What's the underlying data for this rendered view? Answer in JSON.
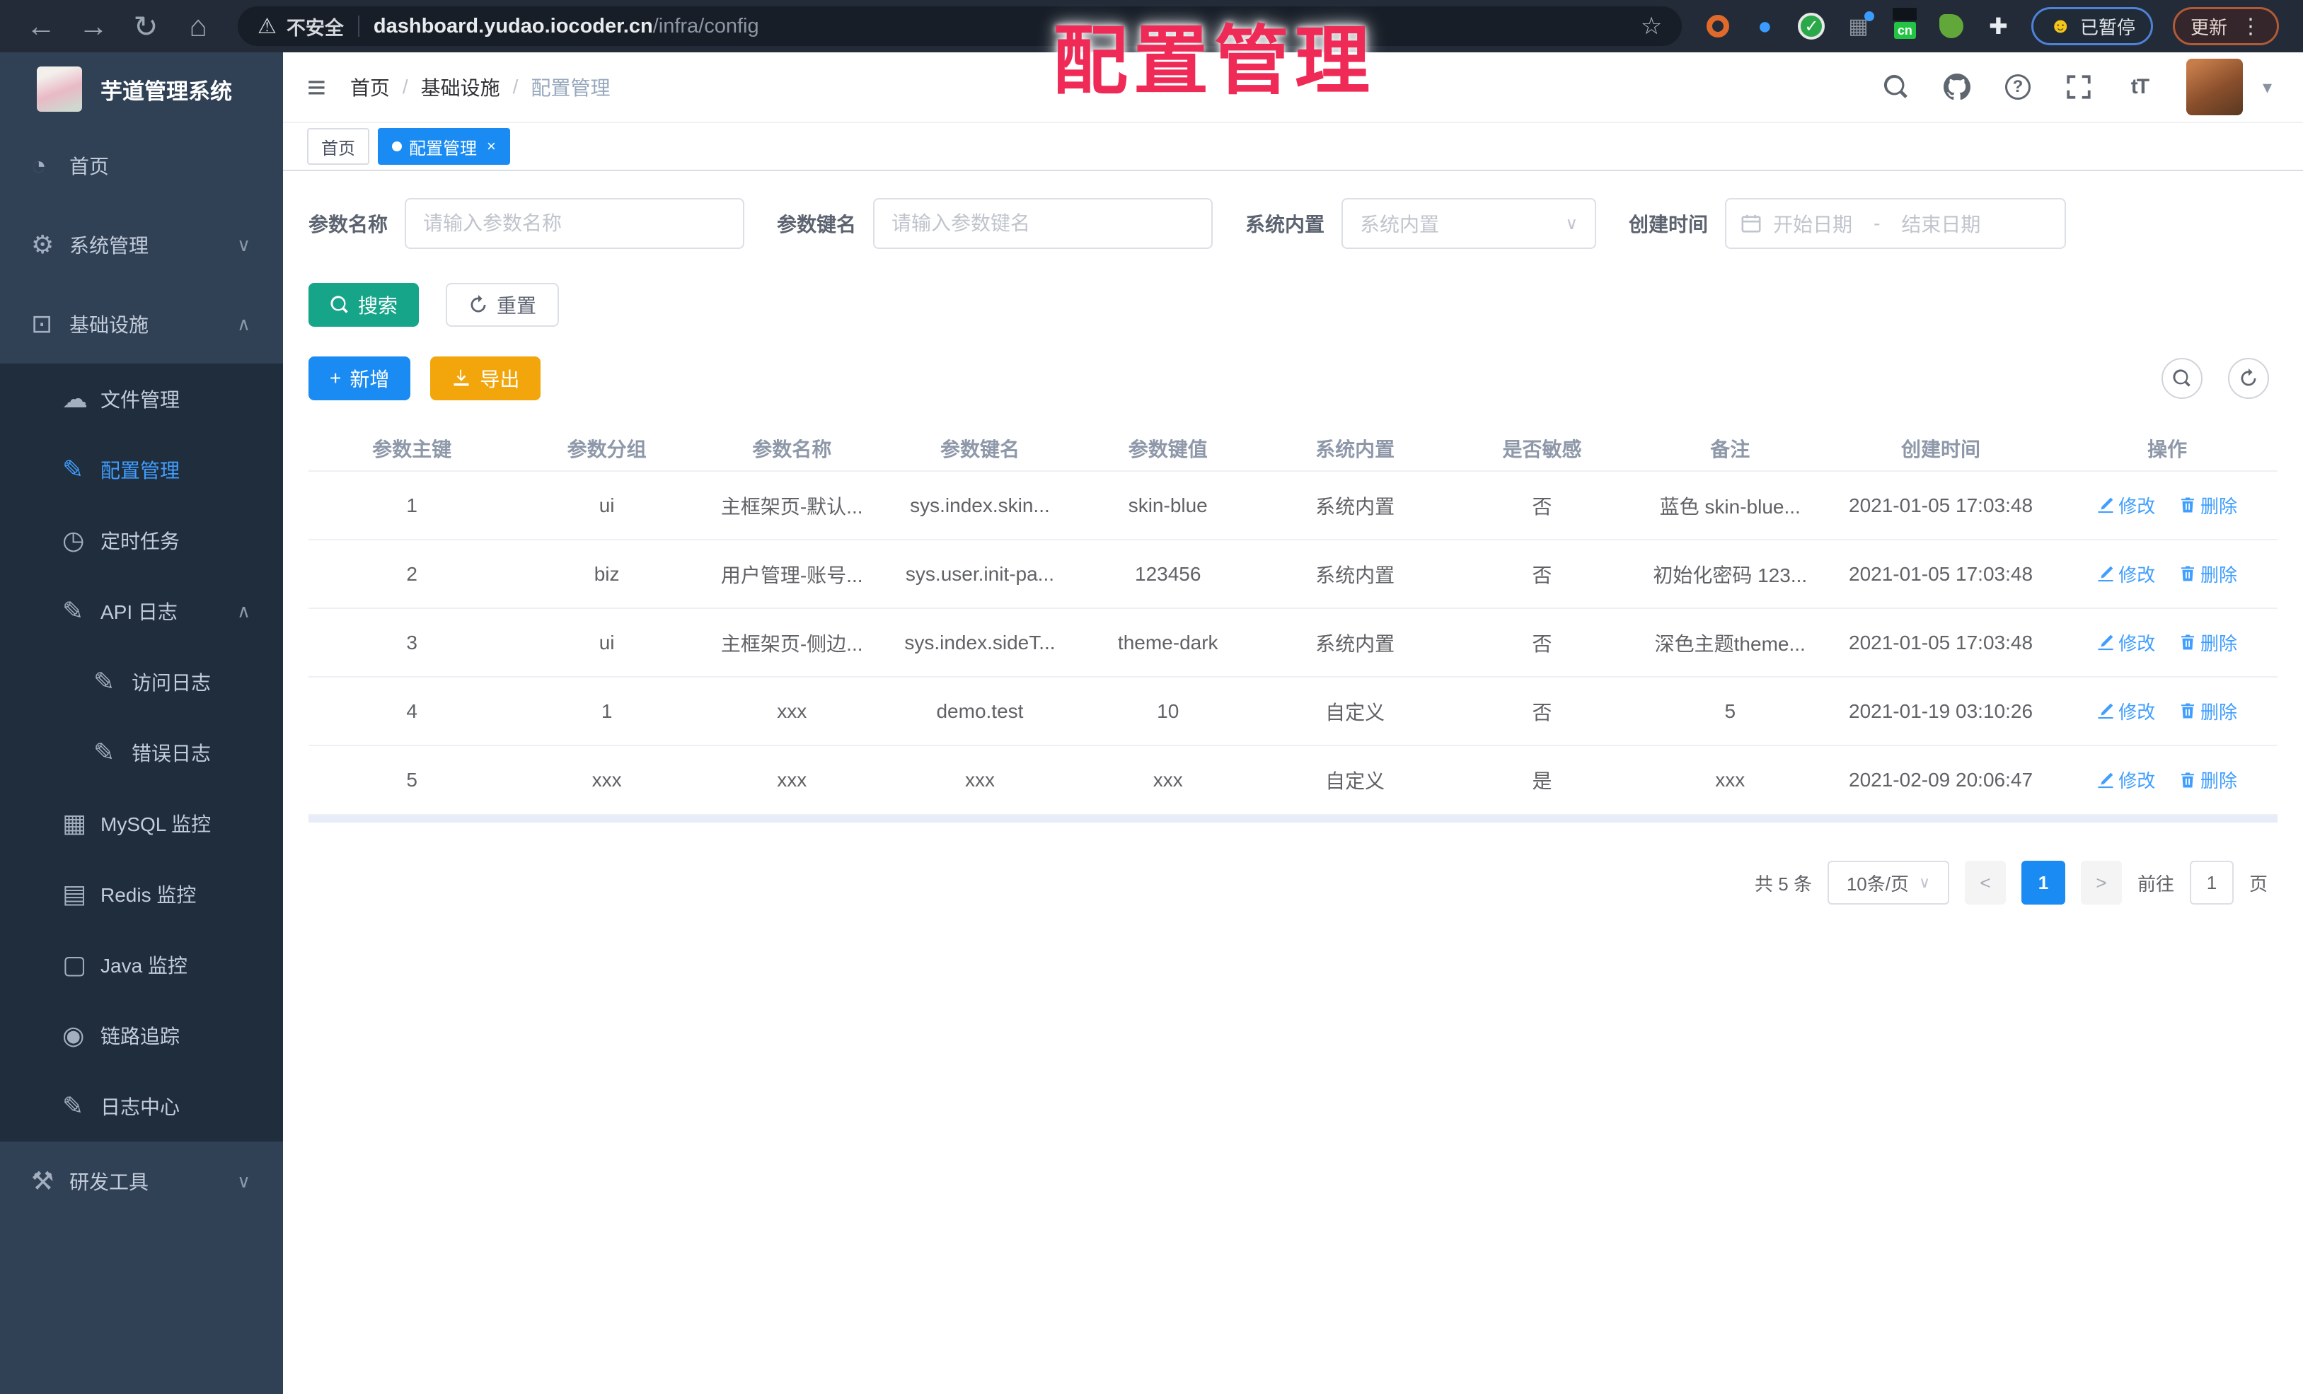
{
  "theme": {
    "accent": "#1a8bf2",
    "link": "#409eff",
    "success": "#16a589",
    "warning": "#f2a60c",
    "sidebar_bg": "#304156",
    "submenu_bg": "#1f2d3d",
    "overlay_red": "#ef2a56"
  },
  "overlay": {
    "title": "配置管理"
  },
  "browser": {
    "security_label": "不安全",
    "url_host": "dashboard.yudao.iocoder.cn",
    "url_path": "/infra/config",
    "paused_badge": "已暂停",
    "update_button": "更新"
  },
  "sidebar": {
    "app_title": "芋道管理系统",
    "items": [
      {
        "label": "首页",
        "glyph": "◔",
        "chevron": ""
      },
      {
        "label": "系统管理",
        "glyph": "⚙",
        "chevron": "∨"
      },
      {
        "label": "基础设施",
        "glyph": "⊡",
        "chevron": "∧"
      },
      {
        "label": "文件管理",
        "glyph": "☁",
        "chevron": ""
      },
      {
        "label": "配置管理",
        "glyph": "✎",
        "chevron": ""
      },
      {
        "label": "定时任务",
        "glyph": "◷",
        "chevron": ""
      },
      {
        "label": "API 日志",
        "glyph": "✎",
        "chevron": "∧"
      },
      {
        "label": "访问日志",
        "glyph": "✎",
        "chevron": ""
      },
      {
        "label": "错误日志",
        "glyph": "✎",
        "chevron": ""
      },
      {
        "label": "MySQL 监控",
        "glyph": "▦",
        "chevron": ""
      },
      {
        "label": "Redis 监控",
        "glyph": "▤",
        "chevron": ""
      },
      {
        "label": "Java 监控",
        "glyph": "▢",
        "chevron": ""
      },
      {
        "label": "链路追踪",
        "glyph": "◉",
        "chevron": ""
      },
      {
        "label": "日志中心",
        "glyph": "✎",
        "chevron": ""
      },
      {
        "label": "研发工具",
        "glyph": "⚒",
        "chevron": "∨"
      }
    ]
  },
  "header": {
    "breadcrumb": [
      "首页",
      "基础设施",
      "配置管理"
    ],
    "font_icon": "tT"
  },
  "tabs": [
    {
      "label": "首页"
    },
    {
      "label": "配置管理",
      "close": "×"
    }
  ],
  "filters": {
    "name_label": "参数名称",
    "name_placeholder": "请输入参数名称",
    "key_label": "参数键名",
    "key_placeholder": "请输入参数键名",
    "builtin_label": "系统内置",
    "builtin_placeholder": "系统内置",
    "time_label": "创建时间",
    "date_start_placeholder": "开始日期",
    "date_separator": "-",
    "date_end_placeholder": "结束日期"
  },
  "actions": {
    "search": "搜索",
    "reset": "重置",
    "add": "新增",
    "export": "导出"
  },
  "table": {
    "columns": [
      "参数主键",
      "参数分组",
      "参数名称",
      "参数键名",
      "参数键值",
      "系统内置",
      "是否敏感",
      "备注",
      "创建时间",
      "操作"
    ],
    "rows": [
      {
        "id": "1",
        "group": "ui",
        "name": "主框架页-默认...",
        "key": "sys.index.skin...",
        "value": "skin-blue",
        "builtin": "系统内置",
        "sensitive": "否",
        "remark": "蓝色 skin-blue...",
        "created": "2021-01-05 17:03:48"
      },
      {
        "id": "2",
        "group": "biz",
        "name": "用户管理-账号...",
        "key": "sys.user.init-pa...",
        "value": "123456",
        "builtin": "系统内置",
        "sensitive": "否",
        "remark": "初始化密码 123...",
        "created": "2021-01-05 17:03:48"
      },
      {
        "id": "3",
        "group": "ui",
        "name": "主框架页-侧边...",
        "key": "sys.index.sideT...",
        "value": "theme-dark",
        "builtin": "系统内置",
        "sensitive": "否",
        "remark": "深色主题theme...",
        "created": "2021-01-05 17:03:48"
      },
      {
        "id": "4",
        "group": "1",
        "name": "xxx",
        "key": "demo.test",
        "value": "10",
        "builtin": "自定义",
        "sensitive": "否",
        "remark": "5",
        "created": "2021-01-19 03:10:26"
      },
      {
        "id": "5",
        "group": "xxx",
        "name": "xxx",
        "key": "xxx",
        "value": "xxx",
        "builtin": "自定义",
        "sensitive": "是",
        "remark": "xxx",
        "created": "2021-02-09 20:06:47"
      }
    ]
  },
  "ops": {
    "edit": "修改",
    "delete": "删除"
  },
  "pagination": {
    "total": "共 5 条",
    "page_size": "10条/页",
    "prev": "<",
    "current": "1",
    "next": ">",
    "goto_label": "前往",
    "goto_value": "1",
    "page_label": "页"
  }
}
